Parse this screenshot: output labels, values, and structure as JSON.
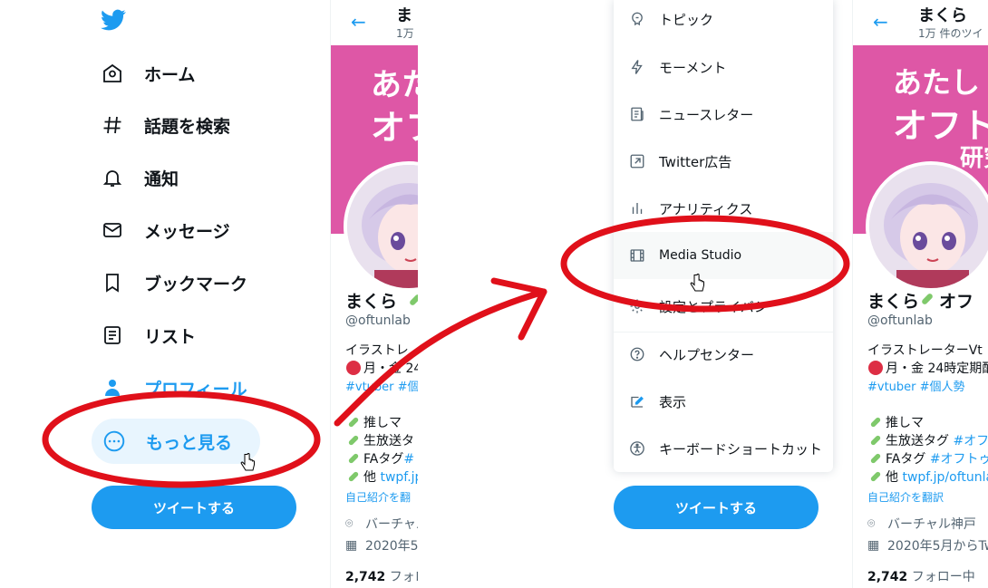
{
  "nav": {
    "items": [
      {
        "label": "ホーム",
        "icon": "home-icon"
      },
      {
        "label": "話題を検索",
        "icon": "hashtag-icon"
      },
      {
        "label": "通知",
        "icon": "bell-icon"
      },
      {
        "label": "メッセージ",
        "icon": "mail-icon"
      },
      {
        "label": "ブックマーク",
        "icon": "bookmark-icon"
      },
      {
        "label": "リスト",
        "icon": "list-icon"
      },
      {
        "label": "プロフィール",
        "icon": "profile-icon"
      },
      {
        "label": "もっと見る",
        "icon": "more-circle-icon"
      }
    ],
    "tweet_button": "ツイートする"
  },
  "profile_left": {
    "header_name": "ま",
    "header_count": "1万",
    "banner_line1": "あた",
    "banner_line2": "オフ",
    "name": "まくら",
    "handle": "@oftunlab",
    "bio1": "イラストレ",
    "bio2": "月・金 24",
    "tags": "#vtuber #個",
    "l1": "推しマ",
    "l2": "生放送タ",
    "l3a": "FAタグ",
    "l3b": "#",
    "l4a": "他",
    "l4b": "twpf.jp",
    "translate": "自己紹介を翻",
    "location": "バーチャル",
    "joined": "2020年5",
    "follow_num": "2,742",
    "follow_label": "フォロ"
  },
  "menu": {
    "items": [
      {
        "label": "トピック",
        "icon": "topic-icon"
      },
      {
        "label": "モーメント",
        "icon": "moment-icon"
      },
      {
        "label": "ニュースレター",
        "icon": "newsletter-icon"
      },
      {
        "label": "Twitter広告",
        "icon": "ads-icon"
      },
      {
        "label": "アナリティクス",
        "icon": "analytics-icon"
      },
      {
        "label": "Media Studio",
        "icon": "media-studio-icon"
      },
      {
        "label": "設定とプライバシ",
        "icon": "settings-icon"
      },
      {
        "label": "ヘルプセンター",
        "icon": "help-icon"
      },
      {
        "label": "表示",
        "icon": "display-icon"
      },
      {
        "label": "キーボードショートカット",
        "icon": "accessibility-icon"
      }
    ],
    "tweet_button": "ツイートする"
  },
  "profile_right": {
    "header_name": "まくら",
    "header_count": "1万 件のツイ",
    "banner_line1": "あたし",
    "banner_line2": "オフト",
    "banner_line3": "研究",
    "name": "まくら",
    "name_suffix": "オフ",
    "handle": "@oftunlab",
    "bio1": "イラストレーターVt",
    "bio2": "月・金 24時定期配",
    "tags": "#vtuber #個人勢",
    "l1": "推しマ",
    "l2a": "生放送タグ",
    "l2b": "#オフ",
    "l3a": "FAタグ",
    "l3b": "#オフトゥ",
    "l4a": "他",
    "l4b": "twpf.jp/oftunla",
    "translate": "自己紹介を翻訳",
    "location": "バーチャル神戸",
    "joined": "2020年5月からTw",
    "follow_num": "2,742",
    "follow_label": "フォロー中"
  },
  "colors": {
    "accent": "#1d9bf0",
    "banner": "#de57a6",
    "annotation": "#e0101a"
  }
}
